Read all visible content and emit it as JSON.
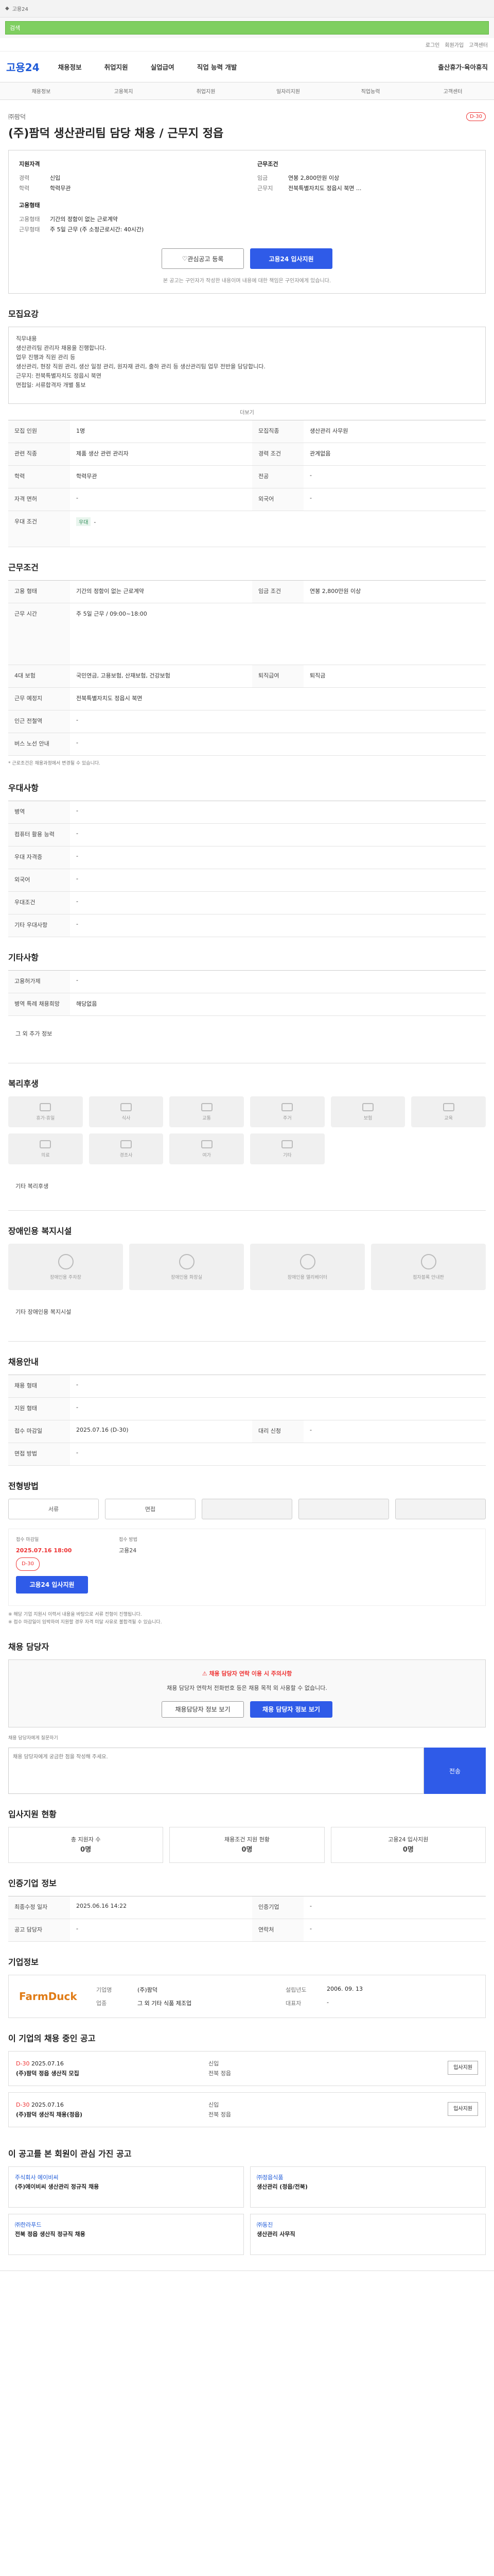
{
  "brand": {
    "logo": "고용24",
    "accent": "#2f5be8"
  },
  "search": {
    "placeholder": "검색"
  },
  "util": [
    "로그인",
    "회원가입",
    "고객센터"
  ],
  "gnb": [
    "채용정보",
    "취업지원",
    "실업급여",
    "직업 능력 개발",
    "출산휴가·육아휴직"
  ],
  "subnav": [
    "채용정보",
    "고용복지",
    "취업지원",
    "일자리지원",
    "직업능력",
    "고객센터"
  ],
  "job": {
    "company": "㈜팜덕",
    "title": "(주)팜덕 생산관리팀 담당 채용 / 근무지 정읍",
    "dday": "D-30",
    "left": [
      [
        "경력",
        "신입"
      ],
      [
        "학력",
        "학력무관"
      ]
    ],
    "right": [
      [
        "임금",
        "연봉 2,800만원 이상"
      ],
      [
        "근무지",
        "전북특별자치도 정읍시 북면 ..."
      ]
    ],
    "left2": [
      [
        "고용형태",
        "기간의 정함이 없는 근로계약"
      ],
      [
        "근무형태",
        "주 5일 근무 (주 소정근로시간: 40시간)"
      ]
    ],
    "save": "관심공고 등록",
    "apply": "고용24 입사지원",
    "note": "본 공고는 구인자가 작성한 내용이며 내용에 대한 책임은 구인자에게 있습니다."
  },
  "sec_recruit": {
    "title": "모집요강",
    "body": "직무내용\n생산관리팀 관리자 채용을 진행합니다.\n업무 진행과 직원 관리 등\n생산관리, 현장 직원 관리, 생산 일정 관리, 원자재 관리, 출하 관리 등 생산관리팀 업무 전반을 담당합니다.\n근무지: 전북특별자치도 정읍시 북면\n면접일: 서류합격자 개별 통보",
    "more": "더보기",
    "rows": [
      [
        "모집 인원",
        "1명",
        "모집직종",
        "생산관리 사무원"
      ],
      [
        "관련 직종",
        "제품 생산 관련 관리자",
        "경력 조건",
        "관계없음"
      ],
      [
        "학력",
        "학력무관",
        "전공",
        "-"
      ],
      [
        "자격 면허",
        "-",
        "외국어",
        "-"
      ],
      [
        "우대 조건",
        "-",
        "",
        ""
      ]
    ]
  },
  "sec_cond": {
    "title": "근무조건",
    "rows": [
      [
        "고용 형태",
        "기간의 정함이 없는 근로계약",
        "임금 조건",
        "연봉 2,800만원 이상"
      ],
      [
        "근무 시간",
        "주 5일 근무 / 09:00~18:00",
        "",
        ""
      ],
      [
        "4대 보험",
        "국민연금, 고용보험, 산재보험, 건강보험",
        "퇴직급여",
        "퇴직금"
      ],
      [
        "근무 예정지",
        "전북특별자치도 정읍시 북면",
        "",
        ""
      ],
      [
        "인근 전철역",
        "-",
        "",
        ""
      ],
      [
        "버스 노선 안내",
        "-",
        "",
        ""
      ]
    ],
    "note": "* 근로조건은 채용과정에서 변경될 수 있습니다."
  },
  "sec_pref": {
    "title": "우대사항",
    "rows": [
      [
        "병역",
        "-"
      ],
      [
        "컴퓨터 활용 능력",
        "-"
      ],
      [
        "우대 자격증",
        "-"
      ],
      [
        "외국어",
        "-"
      ],
      [
        "우대조건",
        "-"
      ],
      [
        "기타 우대사항",
        "-"
      ]
    ]
  },
  "sec_etc": {
    "title": "기타사항",
    "rows": [
      [
        "고용허가제",
        "-"
      ],
      [
        "병역 특례 채용희망",
        "해당없음"
      ]
    ],
    "more": "그 외 추가 정보"
  },
  "sec_welfare": {
    "title": "복리후생",
    "tiles": [
      "휴가·휴일",
      "식사",
      "교통",
      "주거",
      "보험",
      "교육",
      "의료",
      "경조사",
      "여가",
      "기타"
    ],
    "other": "기타 복리후생"
  },
  "sec_disab": {
    "title": "장애인용 복지시설",
    "tiles": [
      "장애인용 주차장",
      "장애인용 화장실",
      "장애인용 엘리베이터",
      "점자블록 안내판"
    ],
    "other": "기타 장애인용 복지시설"
  },
  "sec_hire": {
    "title": "채용안내",
    "rows": [
      [
        "채용 형태",
        "-",
        "",
        ""
      ],
      [
        "지원 형태",
        "-",
        "",
        ""
      ],
      [
        "접수 마감일",
        "2025.07.16 (D-30)",
        "대리 신청",
        "-"
      ],
      [
        "면접 방법",
        "-",
        "",
        ""
      ]
    ]
  },
  "sec_proc": {
    "title": "전형방법",
    "steps": [
      "서류",
      "면접",
      "",
      "",
      ""
    ],
    "deadline": "접수 마감일",
    "date": "2025.07.16 18:00",
    "dday": "D-30",
    "method": "접수 방법",
    "methodv": "고용24",
    "apply": "고용24 입사지원",
    "notes": "※ 해당 기업 지원시 이력서 내용을 바탕으로 서류 전형이 진행됩니다.\n※ 접수 마감일이 임박하여 지원할 경우 자격 미달 사유로 불합격될 수 있습니다."
  },
  "sec_contact": {
    "title": "채용 담당자",
    "alert": "채용 담당자 연락 이용 시 주의사항",
    "body": "채용 담당자 연락처 전화번호 등은 채용 목적 외 사용할 수 없습니다.",
    "btn1": "채용담당자 정보 보기",
    "btn2": "채용 담당자 정보 보기",
    "inquiry_label": "채용 담당자에게 질문하기",
    "inquiry_ph": "채용 담당자에게 궁금한 점을 작성해 주세요.",
    "send": "전송"
  },
  "sec_stats": {
    "title": "입사지원 현황",
    "more": "더보기",
    "items": [
      [
        "총 지원자 수",
        "0명"
      ],
      [
        "채용조건 지원 현황",
        "0명"
      ],
      [
        "고용24 입사지원",
        "0명"
      ]
    ]
  },
  "sec_info": {
    "title": "인증기업 정보",
    "rows": [
      [
        "최종수정 일자",
        "2025.06.16 14:22",
        "인증기업",
        "-"
      ],
      [
        "공고 담당자",
        "-",
        "연락처",
        "-"
      ]
    ]
  },
  "sec_company": {
    "title": "기업정보",
    "name": "FarmDuck",
    "rows": [
      [
        "기업명",
        "(주)팜덕"
      ],
      [
        "업종",
        "그 외 기타 식품 제조업"
      ],
      [
        "대표자",
        "-"
      ],
      [
        "설립년도",
        "2006. 09. 13"
      ]
    ]
  },
  "sec_list": {
    "title": "이 기업의 채용 중인 공고",
    "items": [
      {
        "d": "D-30",
        "date": "2025.07.16",
        "title": "(주)팜덕 정읍 생산직 모집",
        "m1": "신입",
        "m2": "전북 정읍",
        "btn": "입사지원"
      },
      {
        "d": "D-30",
        "date": "2025.07.16",
        "title": "(주)팜덕 생산직 채용(정읍)",
        "m1": "신입",
        "m2": "전북 정읍",
        "btn": "입사지원"
      }
    ]
  },
  "sec_rec": {
    "title": "이 공고를 본 회원이 관심 가진 공고",
    "items": [
      {
        "co": "주식회사 에이비씨",
        "title": "(주)에이비씨 생산관리 정규직 채용"
      },
      {
        "co": "㈜정읍식품",
        "title": "생산관리 (정읍/전북)"
      },
      {
        "co": "㈜한라푸드",
        "title": "전북 정읍 생산직 정규직 채용"
      },
      {
        "co": "㈜동진",
        "title": "생산관리 사무직"
      }
    ]
  }
}
